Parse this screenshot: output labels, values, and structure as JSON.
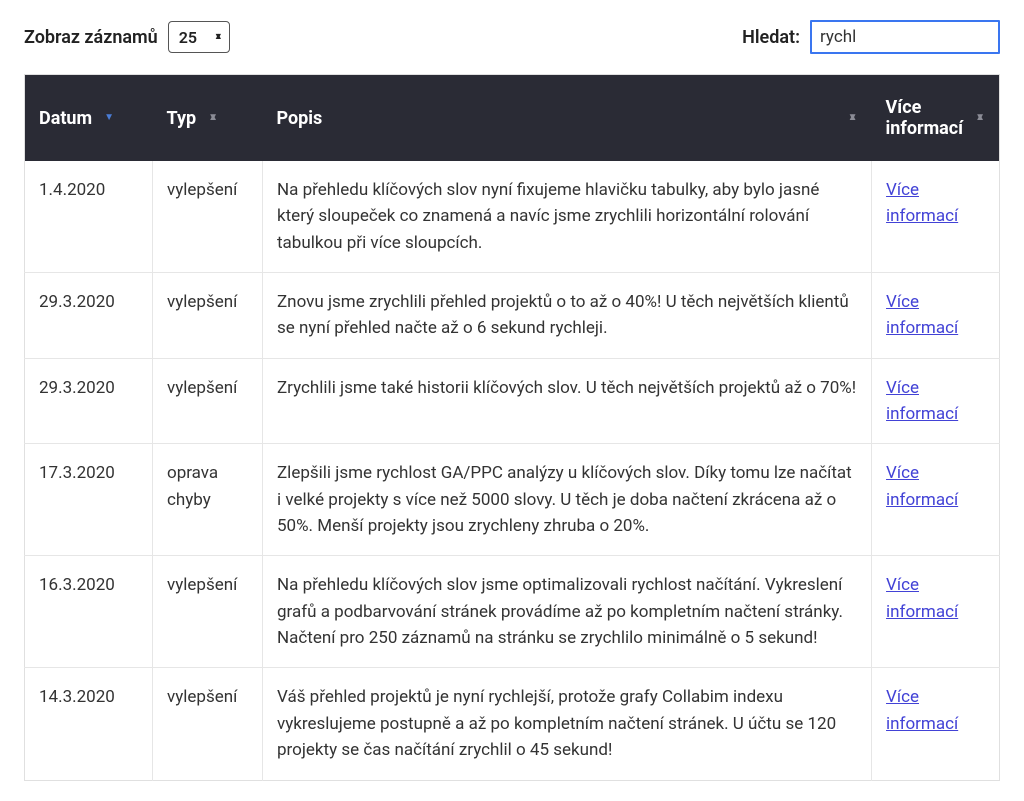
{
  "controls": {
    "records_label": "Zobraz záznamů",
    "records_value": "25",
    "search_label": "Hledat:",
    "search_value": "rychl"
  },
  "table": {
    "headers": {
      "datum": "Datum",
      "typ": "Typ",
      "popis": "Popis",
      "vice": "Více informací"
    },
    "more_link_text": "Více informací",
    "rows": [
      {
        "datum": "1.4.2020",
        "typ": "vylepšení",
        "popis": "Na přehledu klíčových slov nyní fixujeme hlavičku tabulky, aby bylo jasné který sloupeček co znamená a navíc jsme zrychlili horizontální rolování tabulkou při více sloupcích."
      },
      {
        "datum": "29.3.2020",
        "typ": "vylepšení",
        "popis": "Znovu jsme zrychlili přehled projektů o to až o 40%! U těch největších klientů se nyní přehled načte až o 6 sekund rychleji."
      },
      {
        "datum": "29.3.2020",
        "typ": "vylepšení",
        "popis": "Zrychlili jsme také historii klíčových slov. U těch největších projektů až o 70%!"
      },
      {
        "datum": "17.3.2020",
        "typ": "oprava chyby",
        "popis": "Zlepšili jsme rychlost GA/PPC analýzy u klíčových slov. Díky tomu lze načítat i velké projekty s více než 5000 slovy. U těch je doba načtení zkrácena až o 50%. Menší projekty jsou zrychleny zhruba o 20%."
      },
      {
        "datum": "16.3.2020",
        "typ": "vylepšení",
        "popis": "Na přehledu klíčových slov jsme optimalizovali rychlost načítání. Vykreslení grafů a podbarvování stránek provádíme až po kompletním načtení stránky. Načtení pro 250 záznamů na stránku se zrychlilo minimálně o 5 sekund!"
      },
      {
        "datum": "14.3.2020",
        "typ": "vylepšení",
        "popis": "Váš přehled projektů je nyní rychlejší, protože grafy Collabim indexu vykreslujeme postupně a až po kompletním načtení stránek. U účtu se 120 projekty se čas načítání zrychlil o 45 sekund!"
      }
    ]
  }
}
